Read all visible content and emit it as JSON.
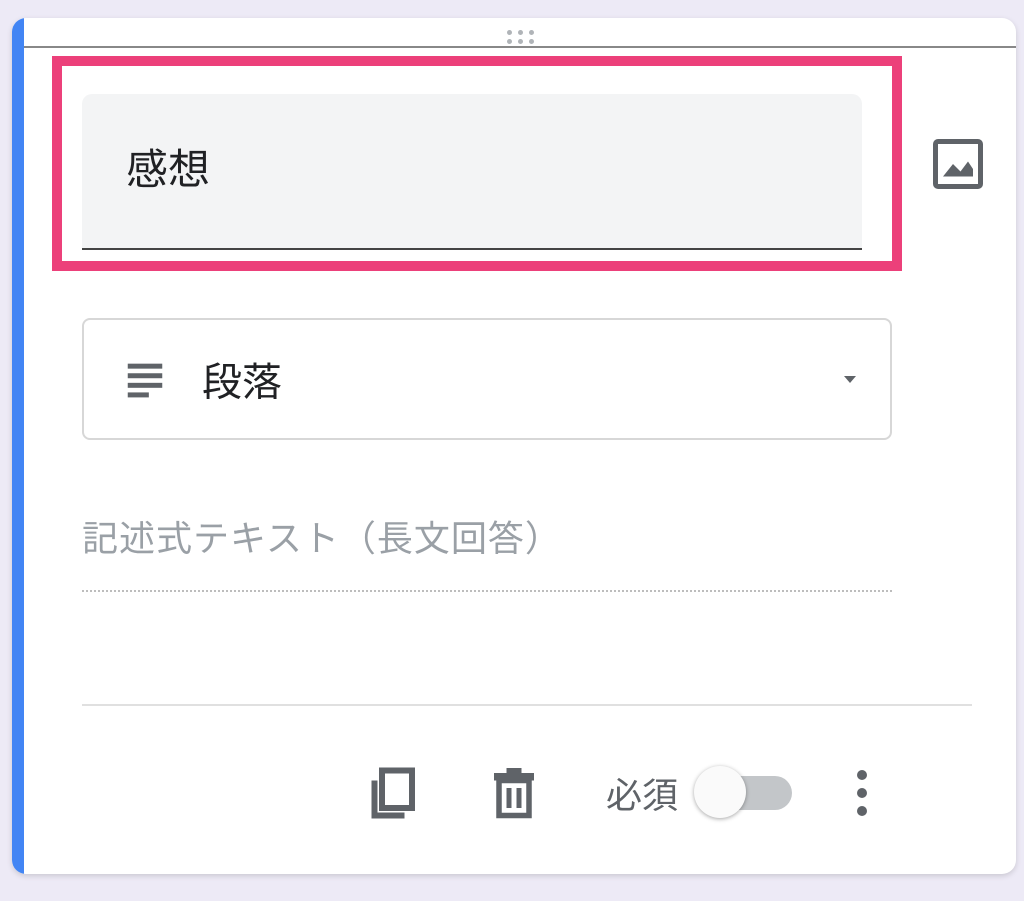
{
  "question": {
    "title": "感想"
  },
  "type_selector": {
    "label": "段落",
    "icon": "paragraph-icon"
  },
  "answer_placeholder": "記述式テキスト（長文回答）",
  "footer": {
    "required_label": "必須",
    "required_on": false
  },
  "icons": {
    "image": "image-icon",
    "copy": "copy-icon",
    "delete": "trash-icon",
    "more": "more-vert-icon",
    "drag": "drag-handle-icon",
    "caret": "caret-down-icon"
  }
}
